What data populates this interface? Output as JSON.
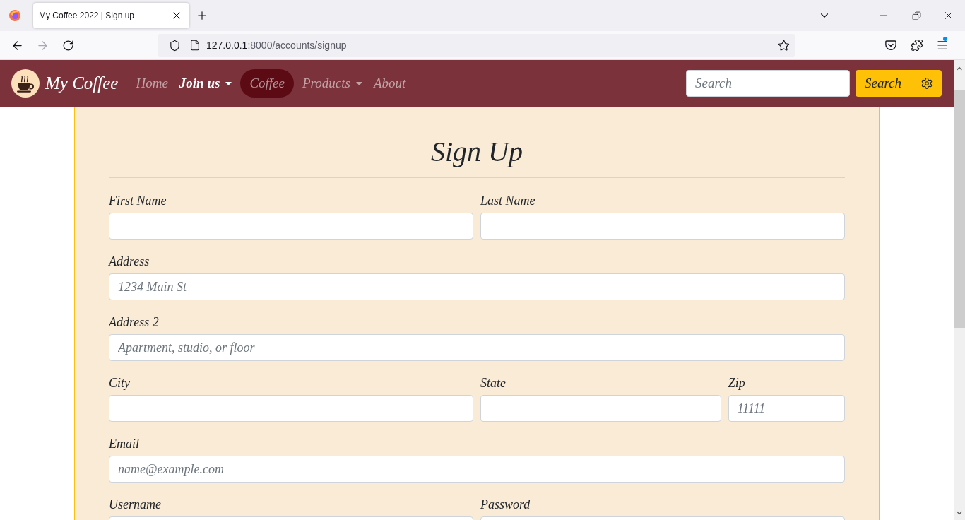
{
  "browser": {
    "tabs": [
      {
        "title": "My Coffee 2022 | Sign up",
        "selected": true
      }
    ],
    "nav_buttons": [
      {
        "kind": "back",
        "disabled": false
      },
      {
        "kind": "forward",
        "disabled": true
      },
      {
        "kind": "reload",
        "disabled": false
      }
    ],
    "address": {
      "host": "127.0.0.1",
      "path": ":8000/accounts/signup"
    },
    "menu_notification": true
  },
  "navbar": {
    "brand": "My Coffee",
    "links": [
      {
        "label": "Home",
        "selected": false,
        "highlighted": false,
        "dropdown": false
      },
      {
        "label": "Join us",
        "selected": true,
        "highlighted": false,
        "dropdown": true
      },
      {
        "label": "Coffee",
        "selected": false,
        "highlighted": true,
        "dropdown": false
      },
      {
        "label": "Products",
        "selected": false,
        "highlighted": false,
        "dropdown": true
      },
      {
        "label": "About",
        "selected": false,
        "highlighted": false,
        "dropdown": false
      }
    ],
    "search": {
      "placeholder": "Search"
    },
    "search_button": "Search"
  },
  "form": {
    "title": "Sign Up",
    "rows": [
      {
        "fields": [
          {
            "label": "First Name"
          },
          {
            "label": "Last Name"
          }
        ]
      },
      {
        "fields": [
          {
            "label": "Address",
            "placeholder": "1234 Main St"
          }
        ]
      },
      {
        "fields": [
          {
            "label": "Address 2",
            "placeholder": "Apartment, studio, or floor"
          }
        ]
      },
      {
        "fields": [
          {
            "label": "City"
          },
          {
            "label": "State"
          },
          {
            "label": "Zip",
            "placeholder": "11111"
          }
        ]
      },
      {
        "fields": [
          {
            "label": "Email",
            "placeholder": "name@example.com"
          }
        ]
      },
      {
        "fields": [
          {
            "label": "Username"
          },
          {
            "label": "Password"
          }
        ]
      }
    ]
  }
}
